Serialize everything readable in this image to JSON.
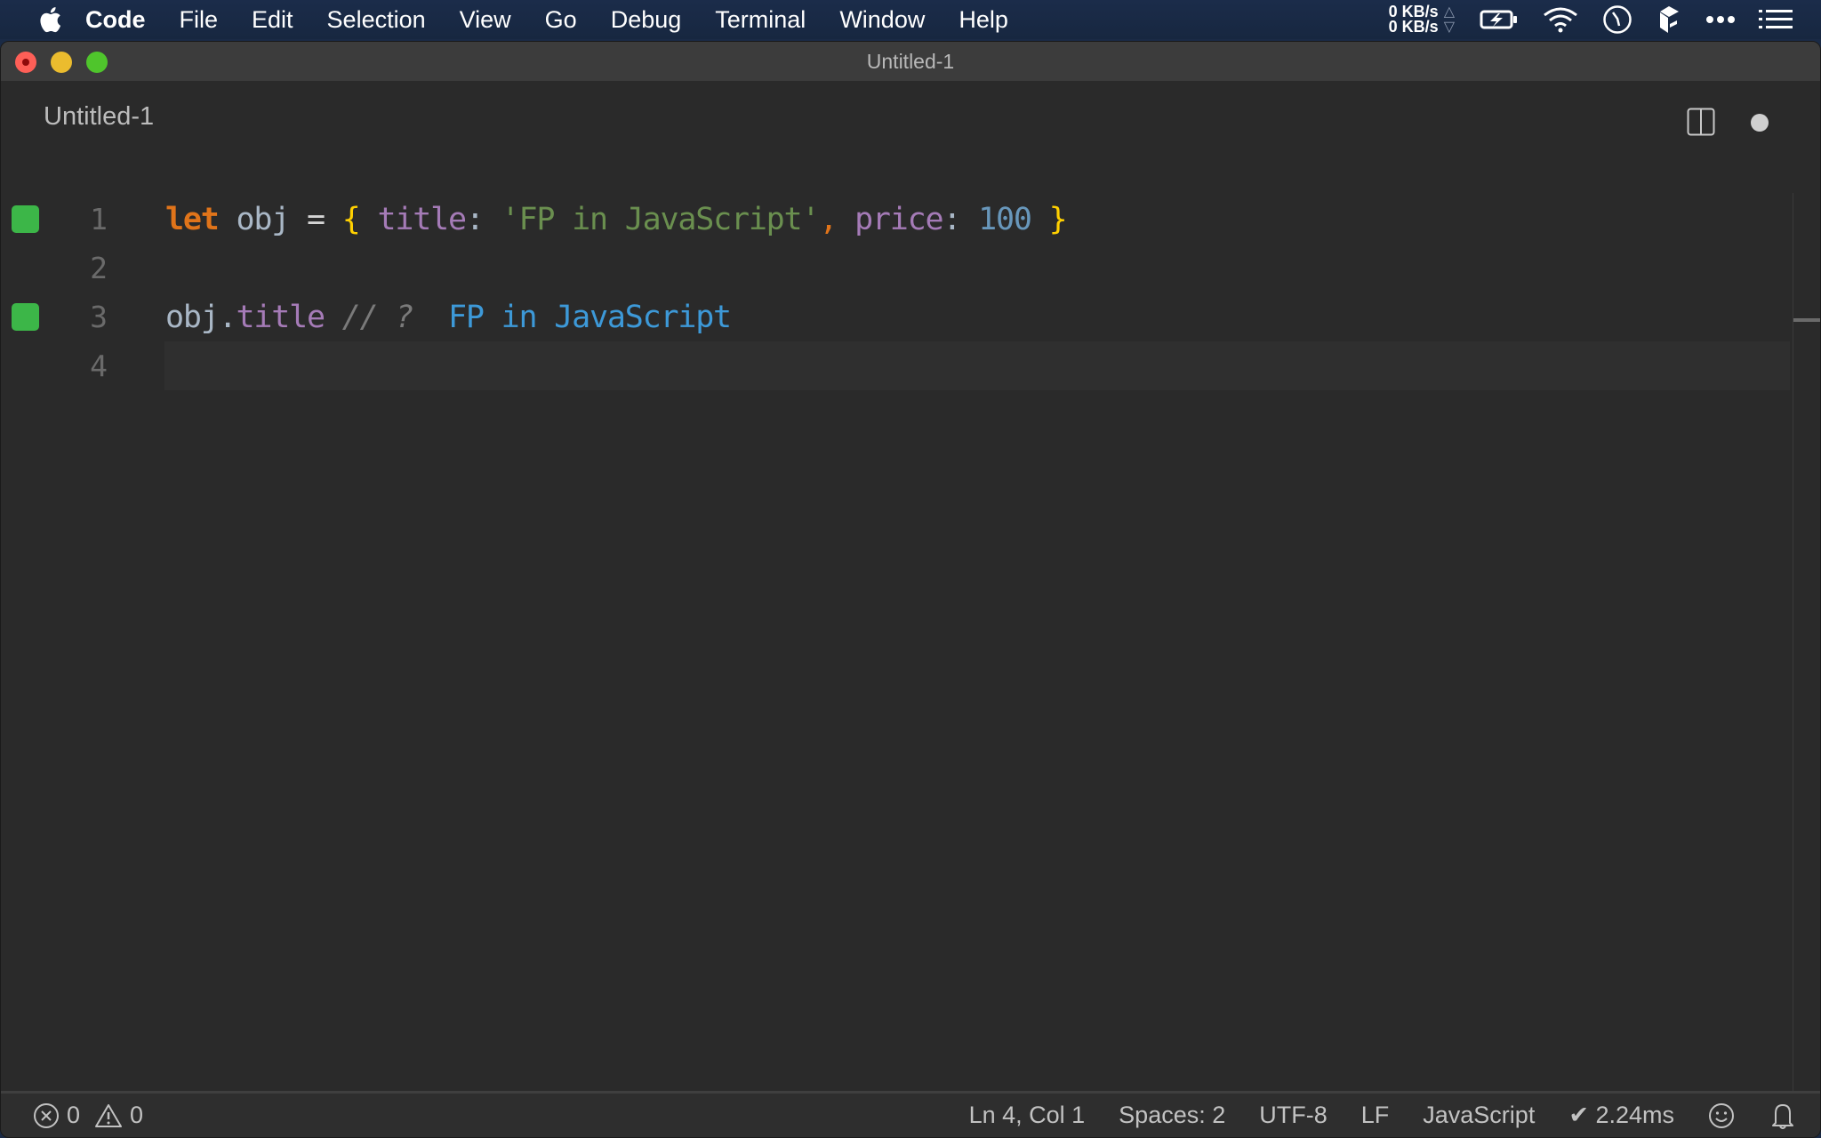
{
  "menubar": {
    "app_name": "Code",
    "items": [
      "File",
      "Edit",
      "Selection",
      "View",
      "Go",
      "Debug",
      "Terminal",
      "Window",
      "Help"
    ],
    "net_up": "0 KB/s",
    "net_down": "0 KB/s",
    "up_arrow": "△",
    "down_arrow": "▽",
    "tray_icons": [
      "battery-charging-icon",
      "wifi-icon",
      "clock-icon",
      "box-app-icon",
      "more-icon",
      "list-icon"
    ]
  },
  "window": {
    "title": "Untitled-1"
  },
  "tab": {
    "label": "Untitled-1",
    "dirty": true
  },
  "editor": {
    "language": "JavaScript",
    "lines": [
      {
        "number": "1",
        "marker": true,
        "tokens": [
          {
            "t": "let",
            "c": "kw"
          },
          {
            "t": " ",
            "c": "op"
          },
          {
            "t": "obj",
            "c": "var"
          },
          {
            "t": " = ",
            "c": "op"
          },
          {
            "t": "{",
            "c": "brace"
          },
          {
            "t": " ",
            "c": "op"
          },
          {
            "t": "title",
            "c": "prop"
          },
          {
            "t": ": ",
            "c": "punc"
          },
          {
            "t": "'FP in JavaScript'",
            "c": "str"
          },
          {
            "t": ",",
            "c": "comma"
          },
          {
            "t": " ",
            "c": "op"
          },
          {
            "t": "price",
            "c": "prop"
          },
          {
            "t": ": ",
            "c": "punc"
          },
          {
            "t": "100",
            "c": "num"
          },
          {
            "t": " ",
            "c": "op"
          },
          {
            "t": "}",
            "c": "brace"
          }
        ]
      },
      {
        "number": "2",
        "marker": false,
        "tokens": []
      },
      {
        "number": "3",
        "marker": true,
        "tokens": [
          {
            "t": "obj",
            "c": "var"
          },
          {
            "t": ".",
            "c": "punc"
          },
          {
            "t": "title",
            "c": "prop"
          },
          {
            "t": " ",
            "c": "op"
          },
          {
            "t": "// ?",
            "c": "comment"
          },
          {
            "t": "  ",
            "c": "op"
          },
          {
            "t": "FP in JavaScript",
            "c": "result"
          }
        ]
      },
      {
        "number": "4",
        "marker": false,
        "current": true,
        "tokens": []
      }
    ],
    "colors": {
      "marker": "#3cb648",
      "keyword": "#e0741a",
      "string": "#6a8f4f",
      "property": "#a57bb7",
      "number": "#6897bb",
      "brace": "#ffd000",
      "result": "#3d99d8"
    }
  },
  "statusbar": {
    "errors": "0",
    "warnings": "0",
    "cursor": "Ln 4, Col 1",
    "indent": "Spaces: 2",
    "encoding": "UTF-8",
    "eol": "LF",
    "language": "JavaScript",
    "timing": "✔ 2.24ms"
  }
}
